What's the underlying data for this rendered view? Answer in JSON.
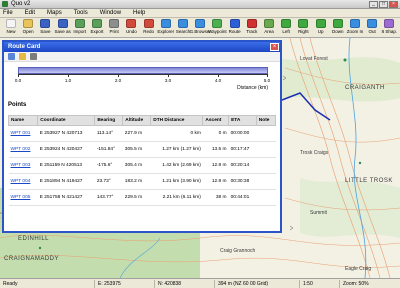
{
  "window": {
    "title": "Quo v2"
  },
  "menu": [
    "File",
    "Edit",
    "Maps",
    "Tools",
    "Window",
    "Help"
  ],
  "toolbar": [
    {
      "label": "New",
      "icon": "new-icon",
      "color": "#f5f5f5"
    },
    {
      "label": "Open",
      "icon": "open-folder-icon",
      "color": "#e8c45a"
    },
    {
      "label": "Save",
      "icon": "save-icon",
      "color": "#3b63c4"
    },
    {
      "label": "Save as",
      "icon": "save-as-icon",
      "color": "#3b63c4"
    },
    {
      "label": "Import",
      "icon": "import-icon",
      "color": "#5aa05a"
    },
    {
      "label": "Export",
      "icon": "export-icon",
      "color": "#5aa05a"
    },
    {
      "label": "Print",
      "icon": "print-icon",
      "color": "#8e8e8e"
    },
    {
      "label": "Undo",
      "icon": "undo-icon",
      "color": "#d04b3b"
    },
    {
      "label": "Redo",
      "icon": "redo-icon",
      "color": "#d04b3b"
    },
    {
      "label": "Explorer",
      "icon": "explorer-icon",
      "color": "#3a8ee0"
    },
    {
      "label": "Search",
      "icon": "search-icon",
      "color": "#3a8ee0"
    },
    {
      "label": "G.Browser",
      "icon": "browser-icon",
      "color": "#3a8ee0"
    },
    {
      "label": "Waypoint",
      "icon": "waypoint-icon",
      "color": "#4caf50"
    },
    {
      "label": "Route",
      "icon": "route-icon",
      "color": "#2e5ed8"
    },
    {
      "label": "Track",
      "icon": "track-icon",
      "color": "#d03030"
    },
    {
      "label": "Area",
      "icon": "area-icon",
      "color": "#6aa84f"
    },
    {
      "label": "Left",
      "icon": "arrow-left-icon",
      "color": "#3fa83f"
    },
    {
      "label": "Right",
      "icon": "arrow-right-icon",
      "color": "#3fa83f"
    },
    {
      "label": "Up",
      "icon": "arrow-up-icon",
      "color": "#3fa83f"
    },
    {
      "label": "Down",
      "icon": "arrow-down-icon",
      "color": "#3fa83f"
    },
    {
      "label": "Zoom In",
      "icon": "zoom-in-icon",
      "color": "#3a8ee0"
    },
    {
      "label": "Out",
      "icon": "zoom-out-icon",
      "color": "#3a8ee0"
    },
    {
      "label": "8 Shap.",
      "icon": "shape-icon",
      "color": "#9c6ad0"
    }
  ],
  "map_labels": {
    "crag_right": "CRAIGANTH",
    "little_trosk": "LITTLE TROSK",
    "edinhill": "EDINHILL",
    "craignamaddy": "CRAIGNAMADDY",
    "eagle_craig": "Eagle Craig",
    "trosk_craigs": "Trosk Craigs",
    "lovat_forest": "Lovat Forest",
    "craig_grannoch": "Craig Grannoch",
    "summit": "Summit"
  },
  "route_card": {
    "title": "Route Card",
    "profile_ticks": [
      "0.0",
      "1.0",
      "2.0",
      "3.0",
      "4.0",
      "5.0"
    ],
    "distance_label": "Distance (km)",
    "points_heading": "Points",
    "columns": [
      "Name",
      "Coordinate",
      "Bearing",
      "Altitude",
      "DTH Distance",
      "Ascent",
      "ETA",
      "Note"
    ],
    "rows": [
      {
        "name": "WPT 001",
        "coord": "E 253927 N 420713",
        "bearing": "113.14°",
        "altitude": "227.9 m",
        "dist": "0 km",
        "ascent": "0 m",
        "eta": "00:00:00",
        "note": ""
      },
      {
        "name": "WPT 002",
        "coord": "E 253924 N 420427",
        "bearing": "-151.84°",
        "altitude": "305.5 m",
        "dist": "1.27 km (1.27 km)",
        "ascent": "13.5 m",
        "eta": "00:17:47",
        "note": ""
      },
      {
        "name": "WPT 003",
        "coord": "E 251159 N 420513",
        "bearing": "-175.6°",
        "altitude": "305.4 m",
        "dist": "1.42 km (2.69 km)",
        "ascent": "12.8 m",
        "eta": "00:20:14",
        "note": ""
      },
      {
        "name": "WPT 004",
        "coord": "E 251894 N 419427",
        "bearing": "23.73°",
        "altitude": "183.2 m",
        "dist": "1.21 km (3.90 km)",
        "ascent": "12.8 m",
        "eta": "00:30:38",
        "note": ""
      },
      {
        "name": "WPT 005",
        "coord": "E 251758 N 421427",
        "bearing": "143.77°",
        "altitude": "229.5 m",
        "dist": "2.21 km (6.11 km)",
        "ascent": "38 m",
        "eta": "00:44:01",
        "note": ""
      }
    ]
  },
  "status": {
    "ready": "Ready",
    "easting": "E: 253975",
    "northing": "N: 420838",
    "grid": "394 m (NZ 60 00 Grid)",
    "scale": "1:50",
    "zoom": "Zoom: 50%"
  }
}
